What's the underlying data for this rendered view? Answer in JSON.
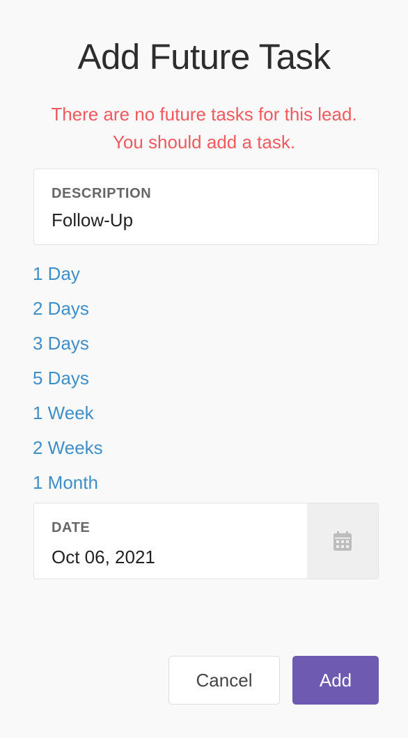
{
  "dialog": {
    "title": "Add Future Task",
    "warning_line1": "There are no future tasks for this lead.",
    "warning_line2": "You should add a task."
  },
  "description": {
    "label": "DESCRIPTION",
    "value": "Follow-Up"
  },
  "quick_options": [
    "1 Day",
    "2 Days",
    "3 Days",
    "5 Days",
    "1 Week",
    "2 Weeks",
    "1 Month"
  ],
  "date": {
    "label": "DATE",
    "value": "Oct 06, 2021",
    "icon": "calendar-icon"
  },
  "buttons": {
    "cancel": "Cancel",
    "add": "Add"
  },
  "colors": {
    "warning": "#f0595e",
    "link": "#3f8fc7",
    "primary": "#6e5bb1"
  }
}
